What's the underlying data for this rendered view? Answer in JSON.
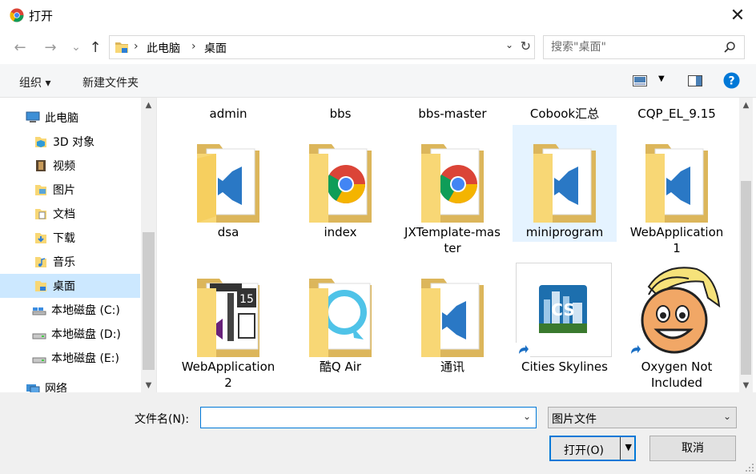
{
  "window": {
    "title": "打开",
    "close_glyph": "✕"
  },
  "nav": {
    "back_glyph": "←",
    "forward_glyph": "→",
    "recent_glyph": "⌄",
    "up_glyph": "↑",
    "breadcrumb": [
      "此电脑",
      "桌面"
    ],
    "breadcrumb_sep": "›",
    "dropdown_glyph": "⌄",
    "refresh_glyph": "↻"
  },
  "search": {
    "placeholder": "搜索\"桌面\""
  },
  "toolbar": {
    "organize": "组织 ▾",
    "new_folder": "新建文件夹"
  },
  "sidebar": {
    "items": [
      {
        "label": "此电脑",
        "icon": "computer-icon"
      },
      {
        "label": "3D 对象",
        "icon": "3d-objects-icon"
      },
      {
        "label": "视频",
        "icon": "videos-icon"
      },
      {
        "label": "图片",
        "icon": "pictures-icon"
      },
      {
        "label": "文档",
        "icon": "documents-icon"
      },
      {
        "label": "下载",
        "icon": "downloads-icon"
      },
      {
        "label": "音乐",
        "icon": "music-icon"
      },
      {
        "label": "桌面",
        "icon": "desktop-icon",
        "selected": true
      },
      {
        "label": "本地磁盘 (C:)",
        "icon": "drive-c-icon"
      },
      {
        "label": "本地磁盘 (D:)",
        "icon": "drive-d-icon"
      },
      {
        "label": "本地磁盘 (E:)",
        "icon": "drive-e-icon"
      },
      {
        "label": "网络",
        "icon": "network-icon"
      }
    ]
  },
  "files": {
    "row0": [
      "admin",
      "bbs",
      "bbs-master",
      "Cobook汇总",
      "CQP_EL_9.15"
    ],
    "row1": [
      "dsa",
      "index",
      "JXTemplate-master",
      "miniprogram",
      "WebApplication1"
    ],
    "row2": [
      "WebApplication2",
      "酷Q Air",
      "通讯",
      "Cities Skylines",
      "Oxygen Not Included"
    ],
    "selected": "miniprogram"
  },
  "bottom": {
    "filename_label": "文件名(N):",
    "filename_value": "",
    "filetype_value": "图片文件",
    "open_label": "打开(O)",
    "cancel_label": "取消"
  },
  "colors": {
    "accent": "#0078d7",
    "selection": "#cce8ff",
    "folder": "#f8d775",
    "help": "#0078d7"
  }
}
